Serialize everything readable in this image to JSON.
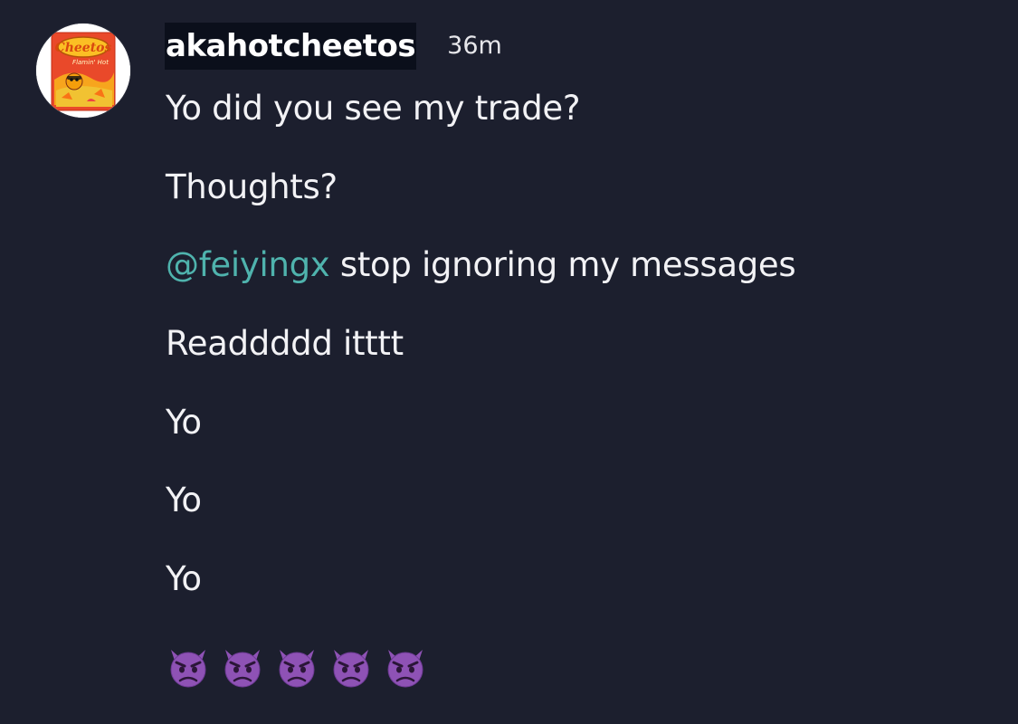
{
  "message": {
    "username": "akahotcheetos",
    "timestamp": "36m",
    "avatar": {
      "logo_text": "Cheetos",
      "subtitle": "Flamin' Hot"
    },
    "lines": [
      "Yo did you see my trade?",
      "Thoughts?",
      {
        "mention": "@feiyingx",
        "text": " stop ignoring my messages"
      },
      "Readdddd itttt",
      "Yo",
      "Yo",
      "Yo"
    ],
    "emoji_reactions": [
      "angry-devil-emoji",
      "angry-devil-emoji",
      "angry-devil-emoji",
      "angry-devil-emoji",
      "angry-devil-emoji"
    ]
  },
  "colors": {
    "background": "#1c1f2e",
    "mention": "#4fb3ad",
    "username_highlight": "#0b0f1b",
    "emoji_purple": "#8e52b5"
  }
}
